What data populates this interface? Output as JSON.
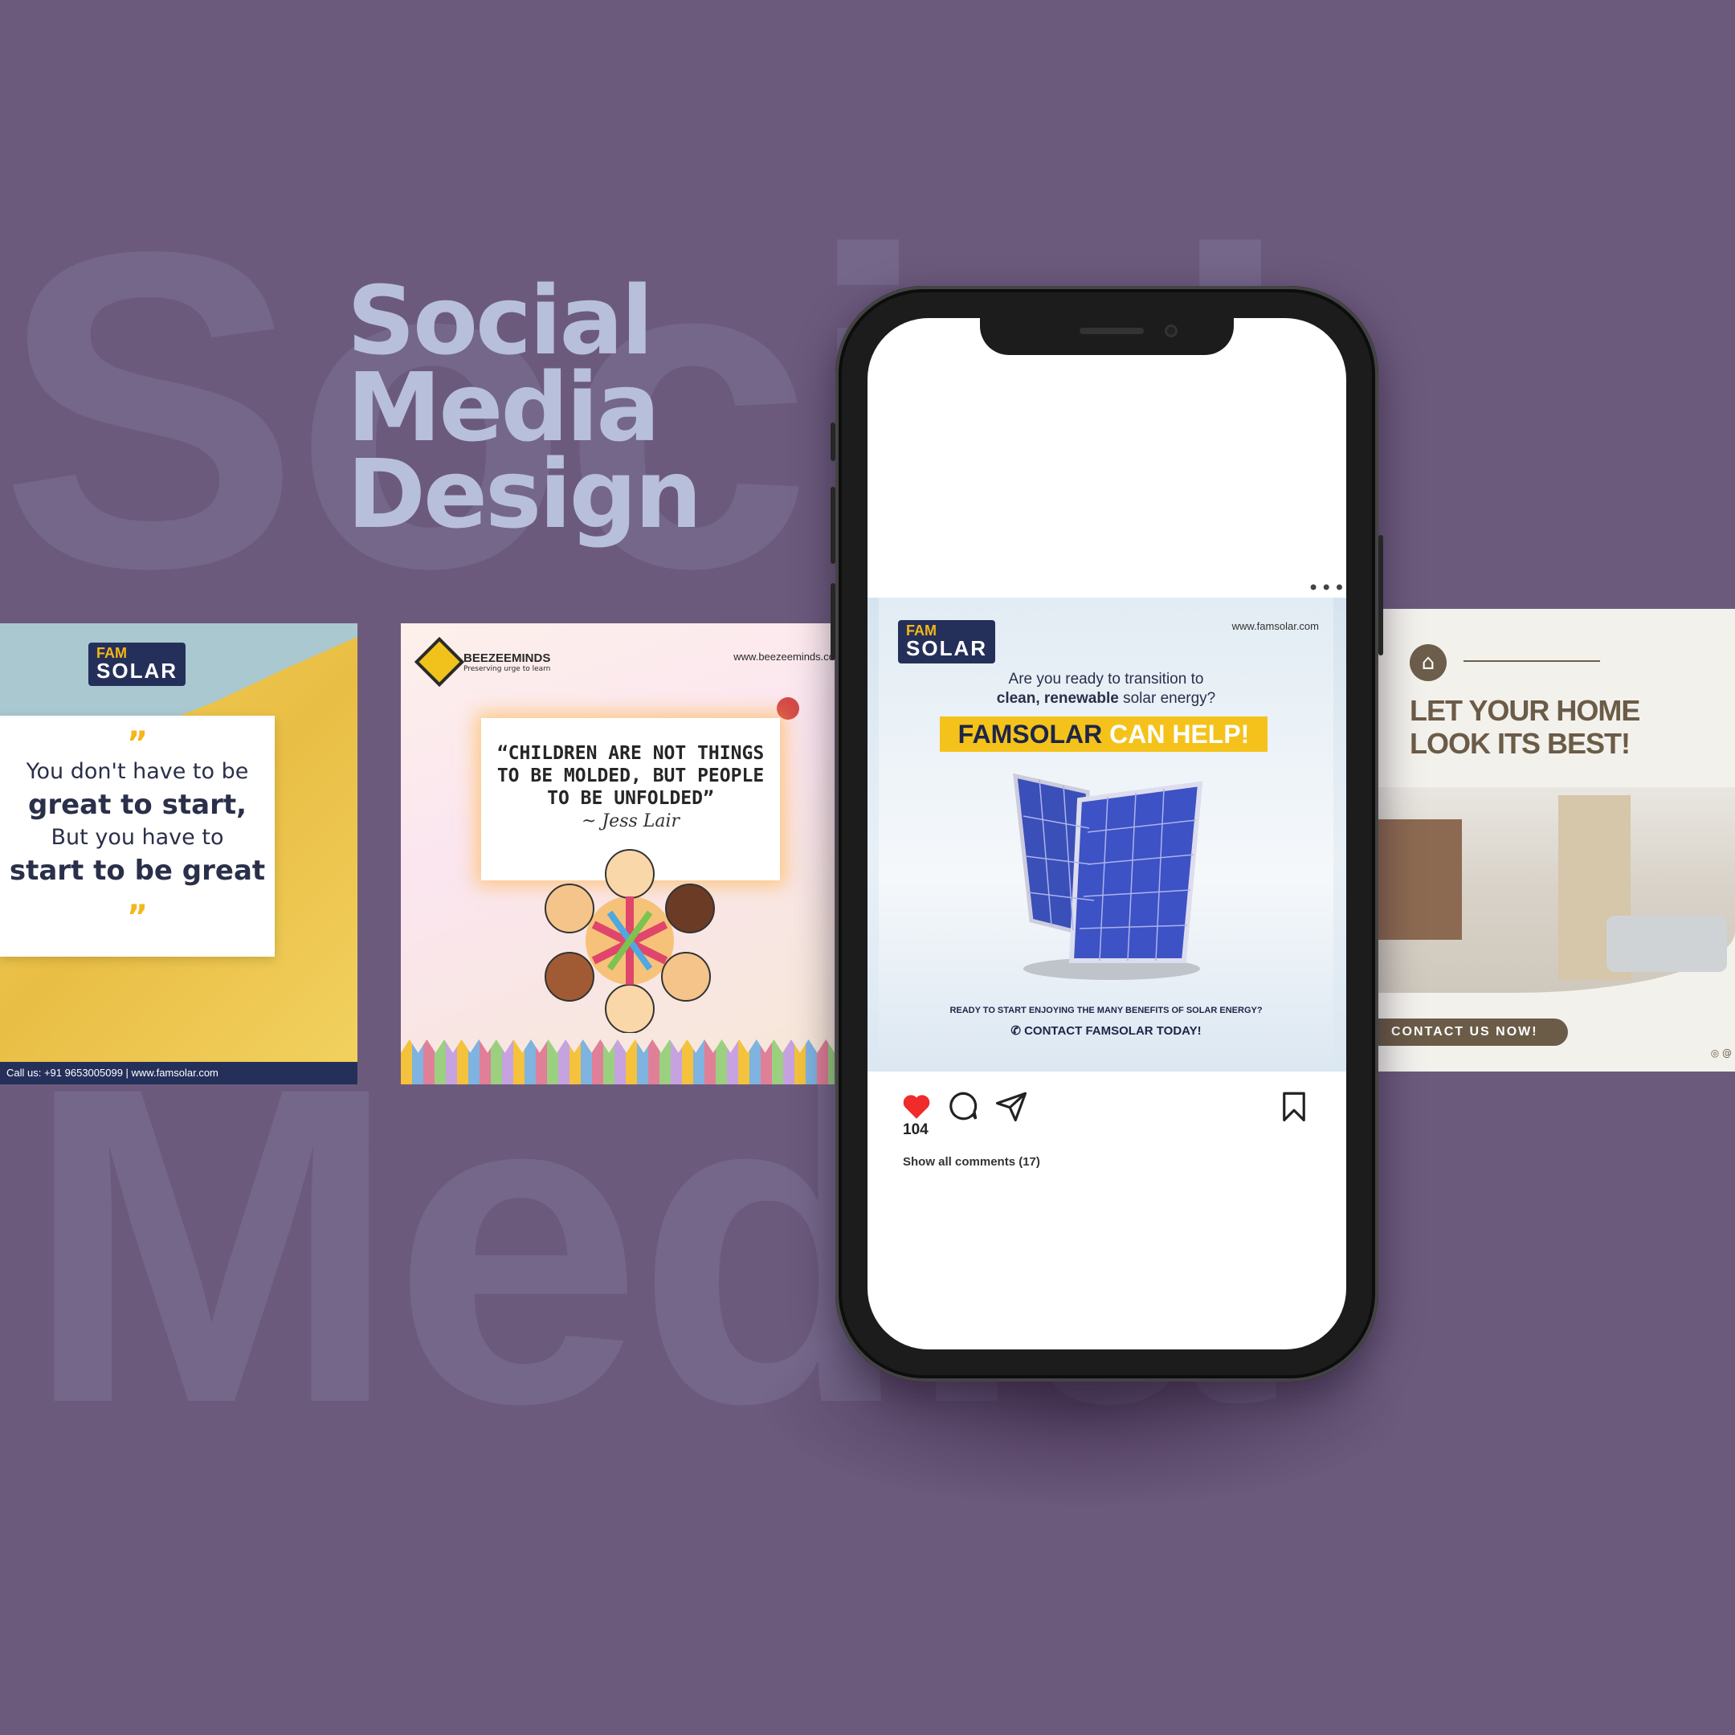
{
  "background": {
    "color": "#6c5a7d",
    "word1": "Social",
    "word2": "Media"
  },
  "headline": {
    "line1": "Social",
    "line2": "Media",
    "line3": "Design"
  },
  "card1": {
    "brand_top": "FAM",
    "brand_bottom": "SOLAR",
    "quote_line1": "You don't have to be",
    "quote_line2": "great to start,",
    "quote_line3": "But you have to",
    "quote_line4": "start to be great",
    "footer": "Call us: +91  9653005099   |   www.famsolar.com"
  },
  "card2": {
    "brand": "BEEZEEMINDS",
    "tagline": "Preserving urge to learn",
    "url": "www.beezeeminds.co",
    "quote": "“CHILDREN ARE NOT THINGS TO BE MOLDED, BUT PEOPLE TO BE UNFOLDED”",
    "author": "~ Jess Lair"
  },
  "card3": {
    "title_line1": "LET YOUR HOME",
    "title_line2": "LOOK ITS BEST!",
    "cta": "CONTACT US NOW!",
    "social": "◎ @"
  },
  "phone": {
    "more_icon": "•••",
    "post": {
      "brand_top": "FAM",
      "brand_bottom": "SOLAR",
      "url": "www.famsolar.com",
      "question_line1": "Are you ready to transition to",
      "question_line2_bold": "clean, renewable",
      "question_line2_rest": " solar energy?",
      "banner_a": "FAMSOLAR",
      "banner_b": " CAN HELP!",
      "sub": "READY TO START ENJOYING THE MANY BENEFITS OF SOLAR ENERGY?",
      "contact": "✆ CONTACT FAMSOLAR TODAY!"
    },
    "likes": "104",
    "comments": "Show all comments (17)",
    "icons": [
      "heart-icon",
      "comment-icon",
      "share-icon",
      "bookmark-icon"
    ]
  }
}
